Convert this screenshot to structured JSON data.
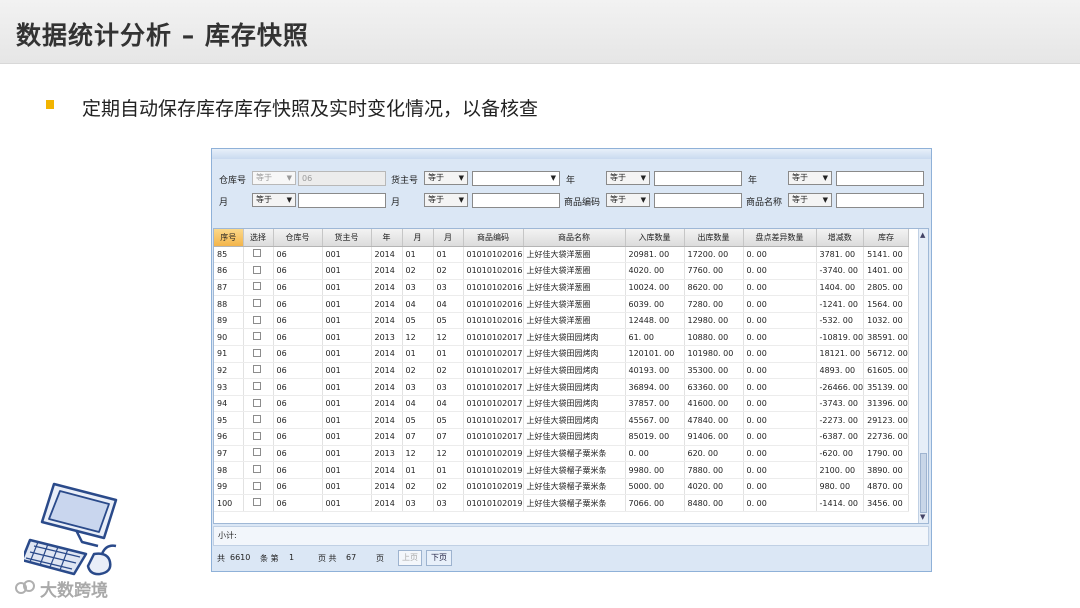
{
  "slide": {
    "title": "数据统计分析 – 库存快照",
    "bullet_text": "定期自动保存库存库存快照及实时变化情况，以备核查",
    "brand": "大数跨境"
  },
  "filters": {
    "row1": {
      "warehouse_label": "仓库号",
      "warehouse_op": "等于",
      "warehouse_value": "06",
      "owner_label": "货主号",
      "owner_op": "等于",
      "owner_value": "",
      "year1_label": "年",
      "year1_op": "等于",
      "year1_value": "",
      "year2_label": "年",
      "year2_op": "等于",
      "year2_value": ""
    },
    "row2": {
      "month1_label": "月",
      "month1_op": "等于",
      "month1_value": "",
      "month2_label": "月",
      "month2_op": "等于",
      "month2_value": "",
      "code_label": "商品编码",
      "code_op": "等于",
      "code_value": "",
      "name_label": "商品名称",
      "name_op": "等于",
      "name_value": ""
    }
  },
  "grid": {
    "columns": [
      "序号",
      "选择",
      "仓库号",
      "货主号",
      "年",
      "月",
      "月",
      "商品编码",
      "商品名称",
      "入库数量",
      "出库数量",
      "盘点差异数量",
      "增减数",
      "库存"
    ],
    "rows": [
      [
        "85",
        "",
        "06",
        "001",
        "2014",
        "01",
        "01",
        "01010102016",
        "上好佳大袋洋葱圈",
        "20981. 00",
        "17200. 00",
        "0. 00",
        "3781. 00",
        "5141. 00"
      ],
      [
        "86",
        "",
        "06",
        "001",
        "2014",
        "02",
        "02",
        "01010102016",
        "上好佳大袋洋葱圈",
        "4020. 00",
        "7760. 00",
        "0. 00",
        "-3740. 00",
        "1401. 00"
      ],
      [
        "87",
        "",
        "06",
        "001",
        "2014",
        "03",
        "03",
        "01010102016",
        "上好佳大袋洋葱圈",
        "10024. 00",
        "8620. 00",
        "0. 00",
        "1404. 00",
        "2805. 00"
      ],
      [
        "88",
        "",
        "06",
        "001",
        "2014",
        "04",
        "04",
        "01010102016",
        "上好佳大袋洋葱圈",
        "6039. 00",
        "7280. 00",
        "0. 00",
        "-1241. 00",
        "1564. 00"
      ],
      [
        "89",
        "",
        "06",
        "001",
        "2014",
        "05",
        "05",
        "01010102016",
        "上好佳大袋洋葱圈",
        "12448. 00",
        "12980. 00",
        "0. 00",
        "-532. 00",
        "1032. 00"
      ],
      [
        "90",
        "",
        "06",
        "001",
        "2013",
        "12",
        "12",
        "01010102017",
        "上好佳大袋田园烤肉",
        "61. 00",
        "10880. 00",
        "0. 00",
        "-10819. 00",
        "38591. 00"
      ],
      [
        "91",
        "",
        "06",
        "001",
        "2014",
        "01",
        "01",
        "01010102017",
        "上好佳大袋田园烤肉",
        "120101. 00",
        "101980. 00",
        "0. 00",
        "18121. 00",
        "56712. 00"
      ],
      [
        "92",
        "",
        "06",
        "001",
        "2014",
        "02",
        "02",
        "01010102017",
        "上好佳大袋田园烤肉",
        "40193. 00",
        "35300. 00",
        "0. 00",
        "4893. 00",
        "61605. 00"
      ],
      [
        "93",
        "",
        "06",
        "001",
        "2014",
        "03",
        "03",
        "01010102017",
        "上好佳大袋田园烤肉",
        "36894. 00",
        "63360. 00",
        "0. 00",
        "-26466. 00",
        "35139. 00"
      ],
      [
        "94",
        "",
        "06",
        "001",
        "2014",
        "04",
        "04",
        "01010102017",
        "上好佳大袋田园烤肉",
        "37857. 00",
        "41600. 00",
        "0. 00",
        "-3743. 00",
        "31396. 00"
      ],
      [
        "95",
        "",
        "06",
        "001",
        "2014",
        "05",
        "05",
        "01010102017",
        "上好佳大袋田园烤肉",
        "45567. 00",
        "47840. 00",
        "0. 00",
        "-2273. 00",
        "29123. 00"
      ],
      [
        "96",
        "",
        "06",
        "001",
        "2014",
        "07",
        "07",
        "01010102017",
        "上好佳大袋田园烤肉",
        "85019. 00",
        "91406. 00",
        "0. 00",
        "-6387. 00",
        "22736. 00"
      ],
      [
        "97",
        "",
        "06",
        "001",
        "2013",
        "12",
        "12",
        "01010102019",
        "上好佳大袋榴子粟米条",
        "0. 00",
        "620. 00",
        "0. 00",
        "-620. 00",
        "1790. 00"
      ],
      [
        "98",
        "",
        "06",
        "001",
        "2014",
        "01",
        "01",
        "01010102019",
        "上好佳大袋榴子粟米条",
        "9980. 00",
        "7880. 00",
        "0. 00",
        "2100. 00",
        "3890. 00"
      ],
      [
        "99",
        "",
        "06",
        "001",
        "2014",
        "02",
        "02",
        "01010102019",
        "上好佳大袋榴子粟米条",
        "5000. 00",
        "4020. 00",
        "0. 00",
        "980. 00",
        "4870. 00"
      ],
      [
        "100",
        "",
        "06",
        "001",
        "2014",
        "03",
        "03",
        "01010102019",
        "上好佳大袋榴子粟米条",
        "7066. 00",
        "8480. 00",
        "0. 00",
        "-1414. 00",
        "3456. 00"
      ]
    ]
  },
  "subtotal_label": "小计:",
  "pager": {
    "total_prefix": "共",
    "total_count": "6610",
    "records_label": "条 第",
    "current_page": "1",
    "pages_label": "页 共",
    "total_pages": "67",
    "page_suffix": "页",
    "prev_label": "上页",
    "next_label": "下页"
  },
  "icons": {
    "computer": "desktop-computer-icon",
    "brand_logo": "brand-logo-icon"
  },
  "colors": {
    "active_header": "#f3b44a",
    "bullet": "#f2b400",
    "window_border": "#8fb1d8"
  }
}
